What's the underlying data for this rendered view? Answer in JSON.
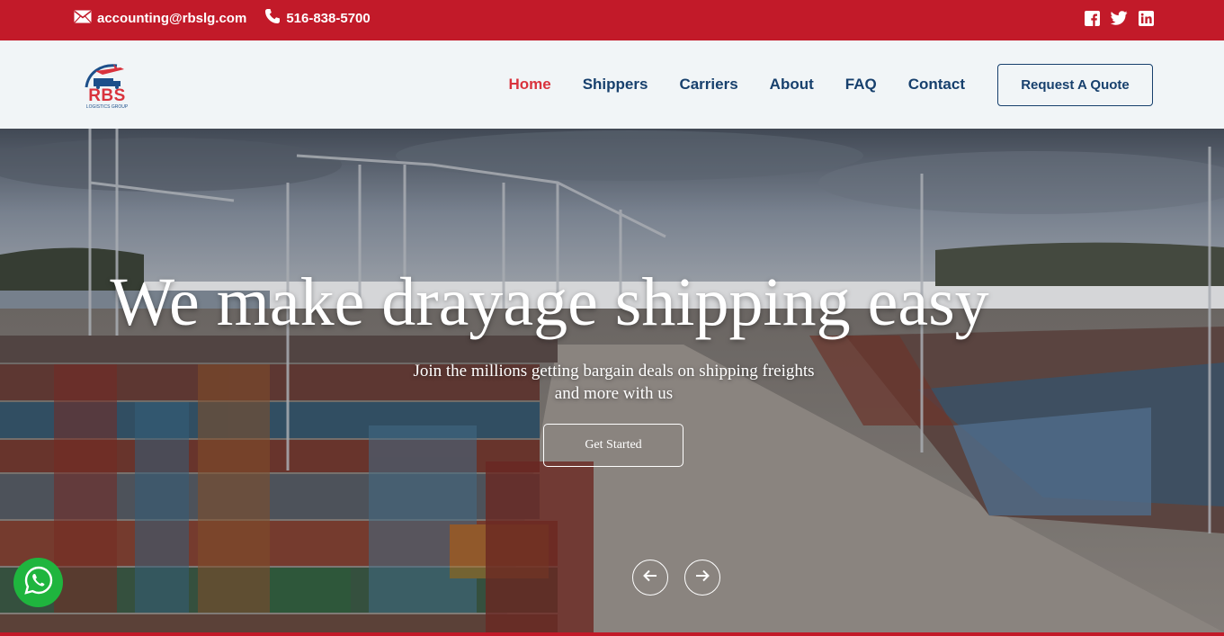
{
  "topbar": {
    "email": "accounting@rbslg.com",
    "phone": "516-838-5700",
    "email_icon": "envelope-icon",
    "phone_icon": "phone-icon",
    "social": [
      "facebook-icon",
      "twitter-icon",
      "linkedin-icon"
    ],
    "background": "#c21a29"
  },
  "logo": {
    "text": "RBS",
    "subtext": "LOGISTICS GROUP"
  },
  "nav": {
    "items": [
      "Home",
      "Shippers",
      "Carriers",
      "About",
      "FAQ",
      "Contact"
    ],
    "active": "Home",
    "quote_button": "Request A Quote"
  },
  "hero": {
    "title": "We make drayage shipping easy",
    "subtitle_line1": "Join the millions getting bargain deals on shipping freights",
    "subtitle_line2": "and more with us",
    "cta": "Get Started",
    "prev_icon": "arrow-left-icon",
    "next_icon": "arrow-right-icon"
  },
  "colors": {
    "accent_red": "#c21a29",
    "nav_blue": "#17406d",
    "active_red": "#d9333d",
    "whatsapp_green": "#1fb53e"
  }
}
